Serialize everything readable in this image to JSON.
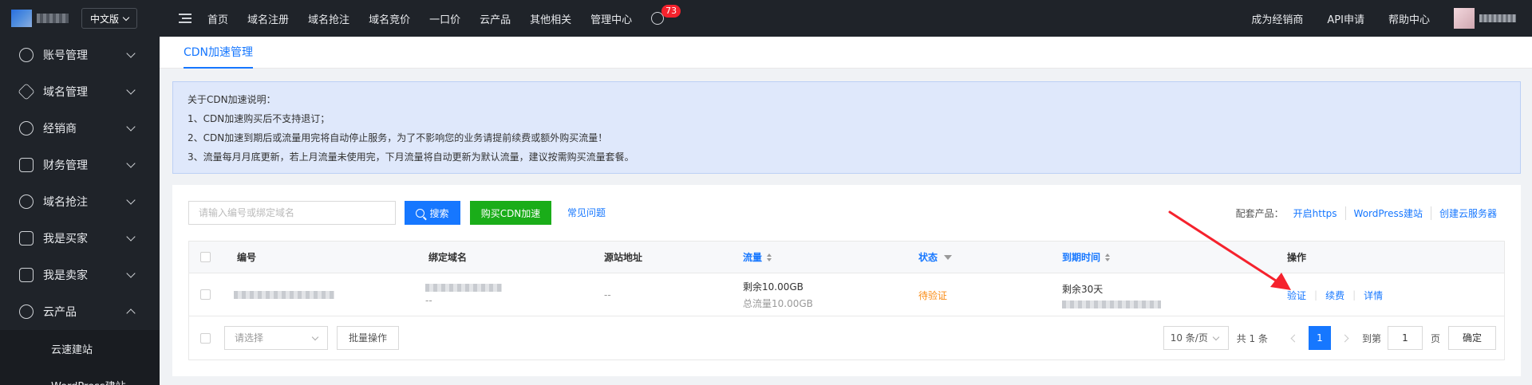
{
  "topbar": {
    "lang": "中文版",
    "nav": [
      "首页",
      "域名注册",
      "域名抢注",
      "域名竞价",
      "一口价",
      "云产品",
      "其他相关",
      "管理中心"
    ],
    "message_count": "73",
    "right_nav": [
      "成为经销商",
      "API申请",
      "帮助中心"
    ]
  },
  "sidebar": {
    "items": [
      {
        "label": "账号管理",
        "icon": "user-icon"
      },
      {
        "label": "域名管理",
        "icon": "layers-icon"
      },
      {
        "label": "经销商",
        "icon": "dealer-icon"
      },
      {
        "label": "财务管理",
        "icon": "finance-icon"
      },
      {
        "label": "域名抢注",
        "icon": "clock-icon"
      },
      {
        "label": "我是买家",
        "icon": "buyer-icon"
      },
      {
        "label": "我是卖家",
        "icon": "seller-icon"
      },
      {
        "label": "云产品",
        "icon": "cloud-icon"
      }
    ],
    "sub_items": [
      "云速建站",
      "WordPress建站"
    ]
  },
  "tab": {
    "label": "CDN加速管理"
  },
  "notice": {
    "lines": [
      "关于CDN加速说明：",
      "1、CDN加速购买后不支持退订；",
      "2、CDN加速到期后或流量用完将自动停止服务，为了不影响您的业务请提前续费或额外购买流量！",
      "3、流量每月月底更新，若上月流量未使用完，下月流量将自动更新为默认流量，建议按需购买流量套餐。"
    ]
  },
  "toolbar": {
    "search_placeholder": "请输入编号或绑定域名",
    "search_label": "搜索",
    "buy_label": "购买CDN加速",
    "faq_label": "常见问题",
    "related_label": "配套产品：",
    "related_links": [
      "开启https",
      "WordPress建站",
      "创建云服务器"
    ]
  },
  "table": {
    "headers": {
      "id": "编号",
      "domain": "绑定域名",
      "origin": "源站地址",
      "traffic": "流量",
      "status": "状态",
      "expire": "到期时间",
      "ops": "操作"
    },
    "row": {
      "domain_sub": "--",
      "origin": "--",
      "traffic_remaining": "剩余10.00GB",
      "traffic_total": "总流量10.00GB",
      "status": "待验证",
      "expire_remaining": "剩余30天",
      "ops": [
        "验证",
        "续费",
        "详情"
      ]
    }
  },
  "footer": {
    "select_placeholder": "请选择",
    "batch_label": "批量操作",
    "page_size": "10 条/页",
    "total": "共 1 条",
    "current_page": "1",
    "goto_label": "到第",
    "goto_value": "1",
    "page_label": "页",
    "confirm_label": "确定"
  },
  "colors": {
    "primary": "#1677ff",
    "green": "#1aad19",
    "pending": "#fa8c16",
    "annotation_arrow": "#f5222d"
  }
}
